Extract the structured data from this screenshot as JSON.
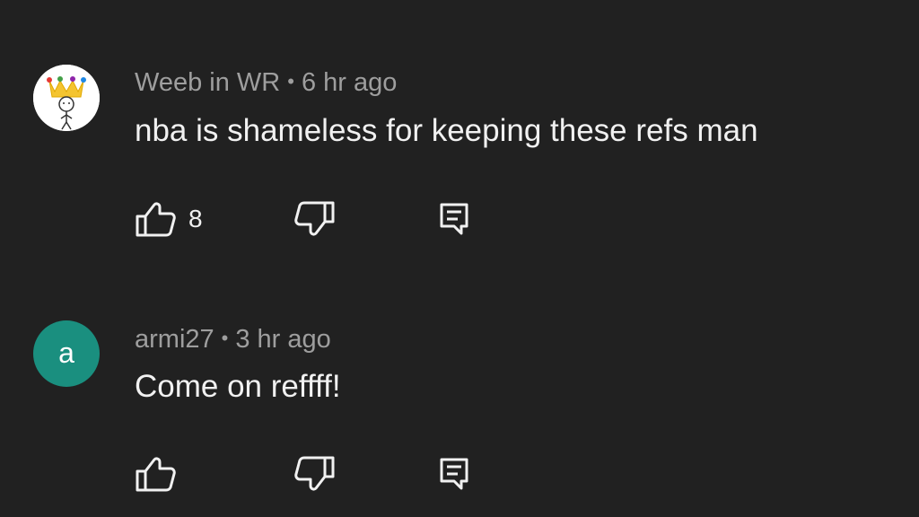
{
  "comments": [
    {
      "author": "Weeb in WR",
      "separator": "•",
      "time": "6 hr ago",
      "text": "nba is shameless for keeping these refs man",
      "avatar": {
        "type": "image",
        "icon": "crowned-stick-figure-icon"
      },
      "likes": "8",
      "icons": {
        "like": "thumbs-up-icon",
        "dislike": "thumbs-down-icon",
        "reply": "reply-icon"
      }
    },
    {
      "author": "armi27",
      "separator": "•",
      "time": "3 hr ago",
      "text": "Come on reffff!",
      "avatar": {
        "type": "letter",
        "letter": "a",
        "color": "#1a8f7f"
      },
      "likes": "",
      "icons": {
        "like": "thumbs-up-icon",
        "dislike": "thumbs-down-icon",
        "reply": "reply-icon"
      }
    }
  ],
  "theme": {
    "background": "#212121",
    "meta_color": "#9e9e9e",
    "text_color": "#f1f1f1"
  }
}
